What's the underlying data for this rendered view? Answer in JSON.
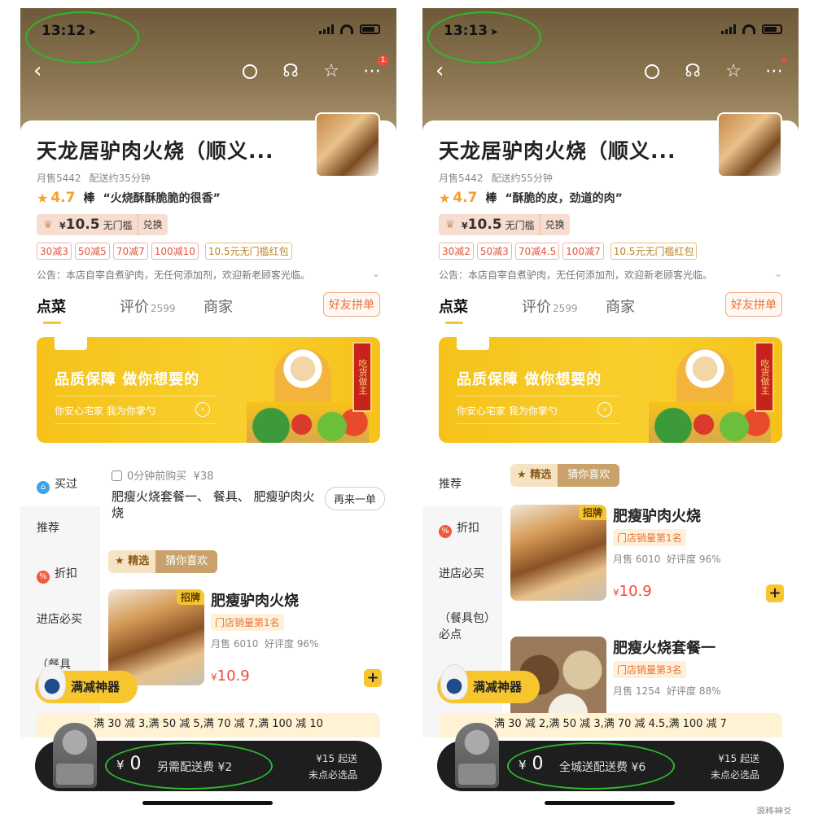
{
  "screens": [
    {
      "status_time": "13:12",
      "store_name": "天龙居驴肉火烧（顺义...",
      "monthly_sales": "月售5442",
      "delivery_time": "配送约35分钟",
      "rating": "4.7",
      "rating_word": "棒",
      "review_quote": "“火烧酥酥脆脆的很香”",
      "coupon_currency": "¥",
      "coupon_amount": "10.5",
      "coupon_desc": "无门槛",
      "coupon_redeem": "兑换",
      "promos": [
        "30减3",
        "50减5",
        "70减7",
        "100减10"
      ],
      "promo_gold": "10.5元无门槛红包",
      "notice": "公告：本店自宰自煮驴肉，无任何添加剂，欢迎新老顾客光临。",
      "tabs": {
        "menu": "点菜",
        "reviews": "评价",
        "reviews_count": "2599",
        "merchant": "商家"
      },
      "group_button": "好友拼单",
      "banner": {
        "title": "品质保障 做你想要的",
        "subtitle": "你安心宅家 我为你掌勺",
        "scroll": "吃货做主"
      },
      "sidebar": [
        "买过",
        "推荐",
        "折扣",
        "进店必买",
        "（餐具"
      ],
      "recent": {
        "time": "0分钟前购买",
        "price": "¥38",
        "title": "肥瘦火烧套餐一、 餐具、 肥瘦驴肉火烧",
        "again": "再来一单"
      },
      "sel_tag": {
        "a": "精选",
        "b": "猜你喜欢"
      },
      "dishes": [
        {
          "badge": "招牌",
          "name": "肥瘦驴肉火烧",
          "rank": "门店销量第1名",
          "sales": "月售 6010",
          "score": "好评度 96%",
          "currency": "¥",
          "price": "10.9"
        }
      ],
      "full_reduce_label": "满减神器",
      "promo_strip": "满 30 减 3,满 50 减 5,满 70 减 7,满 100 减 10",
      "cart": {
        "currency": "¥",
        "amount": "0",
        "fee": "另需配送费 ¥2",
        "start": "¥15 起送",
        "must": "未点必选品"
      },
      "watermark": ""
    },
    {
      "status_time": "13:13",
      "store_name": "天龙居驴肉火烧（顺义...",
      "monthly_sales": "月售5442",
      "delivery_time": "配送约55分钟",
      "rating": "4.7",
      "rating_word": "棒",
      "review_quote": "“酥脆的皮，劲道的肉”",
      "coupon_currency": "¥",
      "coupon_amount": "10.5",
      "coupon_desc": "无门槛",
      "coupon_redeem": "兑换",
      "promos": [
        "30减2",
        "50减3",
        "70减4.5",
        "100减7"
      ],
      "promo_gold": "10.5元无门槛红包",
      "notice": "公告：本店自宰自煮驴肉，无任何添加剂，欢迎新老顾客光临。",
      "tabs": {
        "menu": "点菜",
        "reviews": "评价",
        "reviews_count": "2599",
        "merchant": "商家"
      },
      "group_button": "好友拼单",
      "banner": {
        "title": "品质保障 做你想要的",
        "subtitle": "你安心宅家 我为你掌勺",
        "scroll": "吃货做主"
      },
      "sidebar": [
        "推荐",
        "折扣",
        "进店必买",
        "（餐具包）必点"
      ],
      "sel_tag": {
        "a": "精选",
        "b": "猜你喜欢"
      },
      "dishes": [
        {
          "badge": "招牌",
          "name": "肥瘦驴肉火烧",
          "rank": "门店销量第1名",
          "sales": "月售 6010",
          "score": "好评度 96%",
          "currency": "¥",
          "price": "10.9"
        },
        {
          "badge": "",
          "name": "肥瘦火烧套餐一",
          "rank": "门店销量第3名",
          "sales": "月售 1254",
          "score": "好评度 88%",
          "currency": "",
          "price": ""
        }
      ],
      "full_reduce_label": "满减神器",
      "promo_strip": "满 30 减 2,满 50 减 3,满 70 减 4.5,满 100 减 7",
      "cart": {
        "currency": "¥",
        "amount": "0",
        "fee": "全城送配送费 ¥6",
        "start": "¥15 起送",
        "must": "未点必选品"
      },
      "watermark": "源移神爻"
    }
  ],
  "colors": {
    "accent": "#f7c62f",
    "price": "#f04a3a",
    "annotation": "#2eb82e"
  }
}
